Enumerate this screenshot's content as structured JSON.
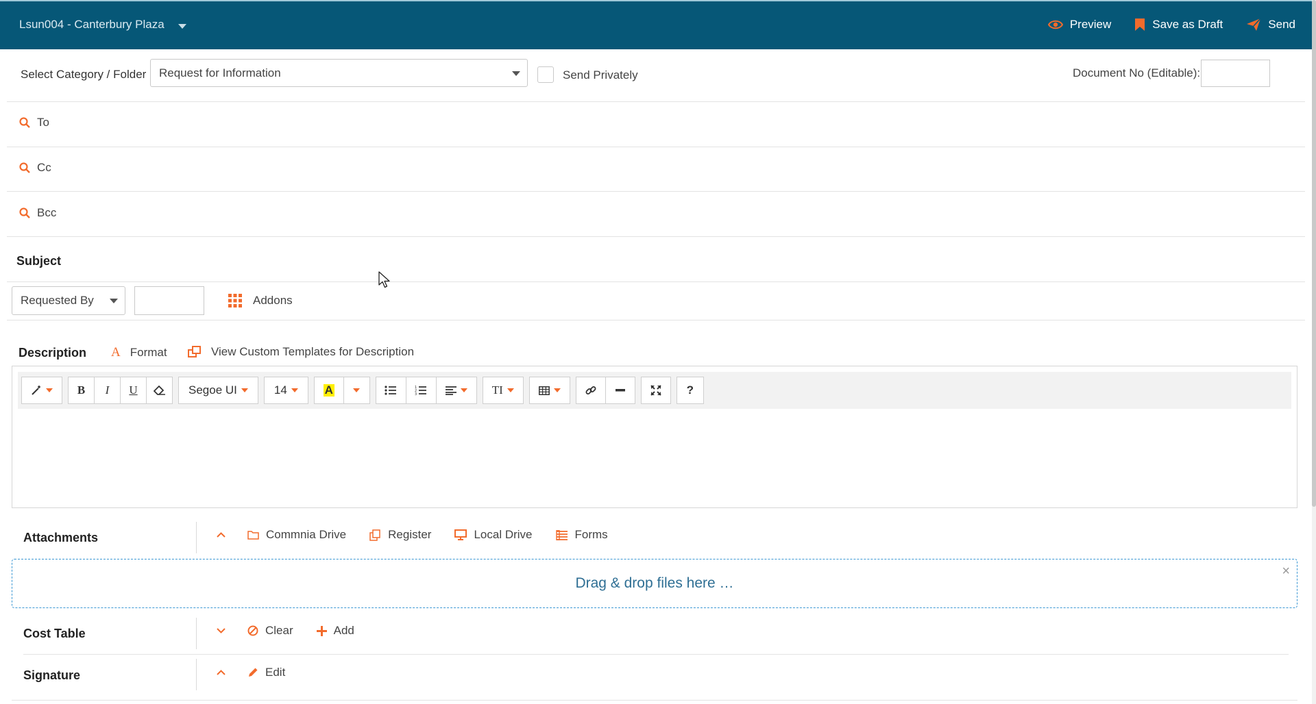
{
  "header": {
    "project": "Lsun004 - Canterbury Plaza",
    "preview": "Preview",
    "save_draft": "Save as Draft",
    "send": "Send"
  },
  "category": {
    "label": "Select Category / Folder",
    "value": "Request for Information",
    "send_privately": "Send Privately",
    "doc_no_label": "Document No (Editable):"
  },
  "recipients": {
    "to": "To",
    "cc": "Cc",
    "bcc": "Bcc"
  },
  "subject": {
    "label": "Subject"
  },
  "requested": {
    "select": "Requested By",
    "addons": "Addons"
  },
  "description": {
    "label": "Description",
    "format": "Format",
    "templates": "View Custom Templates for Description"
  },
  "toolbar": {
    "bold": "B",
    "italic": "I",
    "underline": "U",
    "font": "Segoe UI",
    "size": "14",
    "highlight": "A",
    "text_style": "TI",
    "help": "?"
  },
  "attachments": {
    "label": "Attachments",
    "commnia_drive": "Commnia Drive",
    "register": "Register",
    "local_drive": "Local Drive",
    "forms": "Forms",
    "dropzone": "Drag & drop files here …",
    "close": "×"
  },
  "cost_table": {
    "label": "Cost Table",
    "clear": "Clear",
    "add": "Add"
  },
  "signature": {
    "label": "Signature",
    "edit": "Edit"
  },
  "colors": {
    "header_bg": "#065777",
    "accent": "#f26b2c",
    "dropzone_border": "#3a97d4"
  }
}
